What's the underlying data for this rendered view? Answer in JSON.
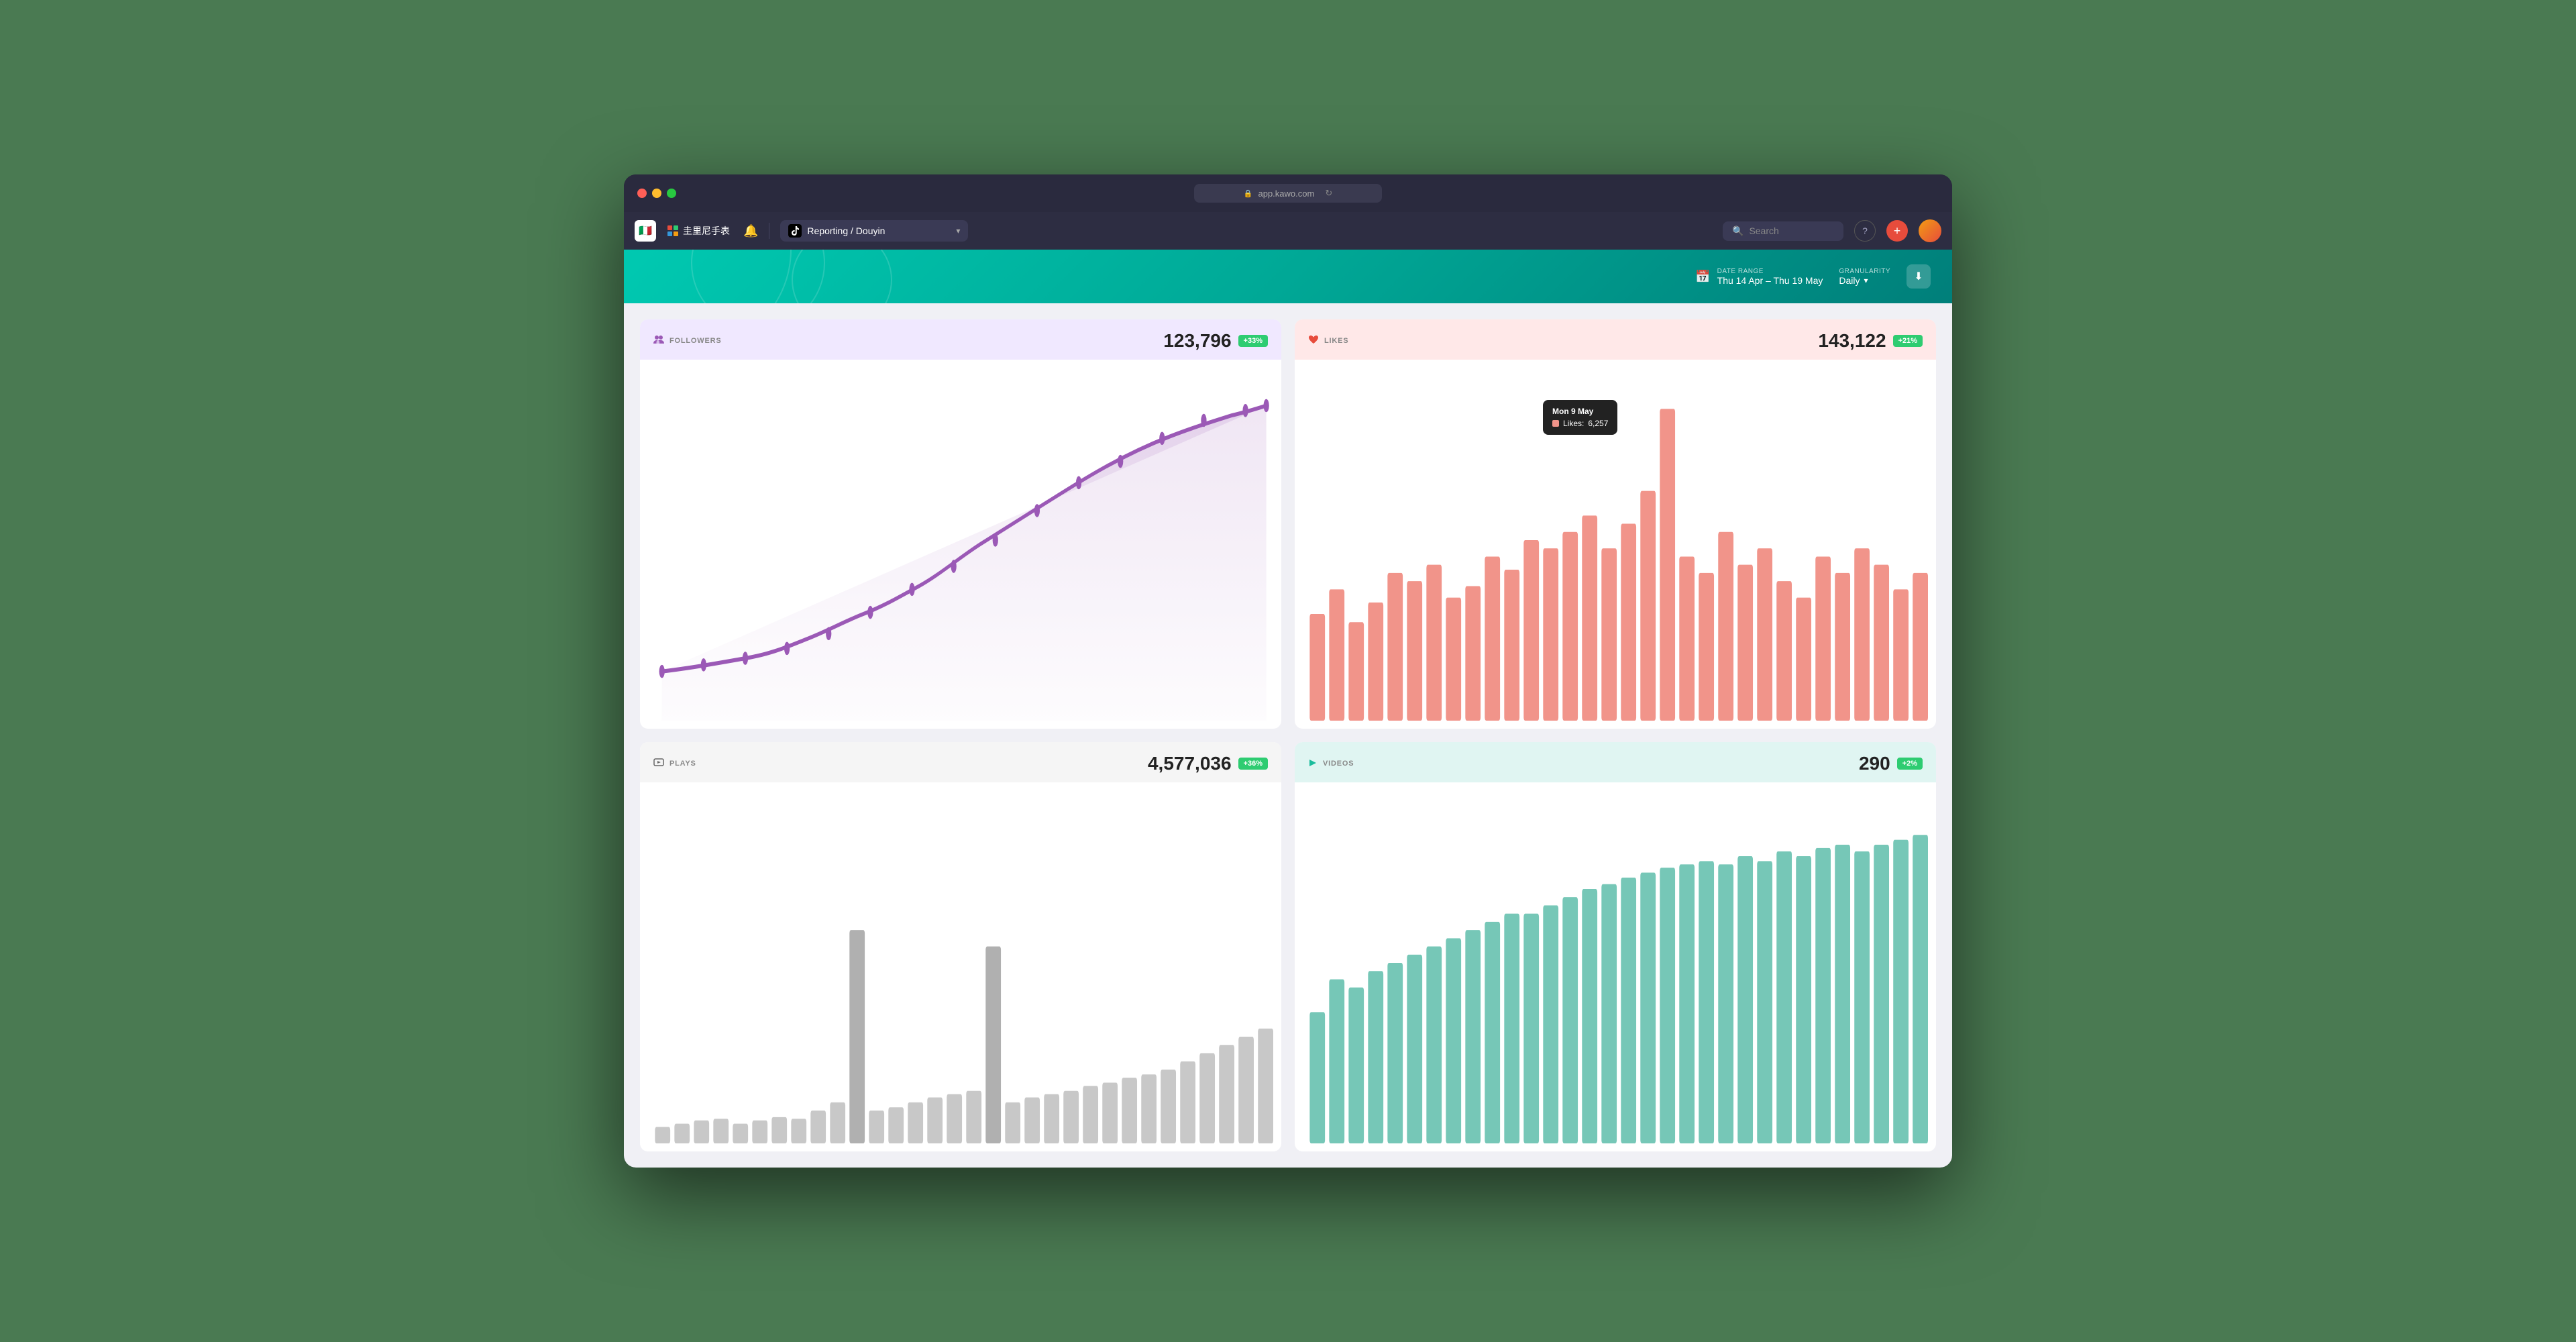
{
  "window": {
    "title": "app.kawo.com"
  },
  "nav": {
    "logo_emoji": "🇮🇹",
    "account_name": "圭里尼手表",
    "bell_label": "🔔",
    "platform": "Reporting / Douyin",
    "chevron": "▾",
    "search_placeholder": "Search",
    "help_label": "?",
    "add_label": "+"
  },
  "report_header": {
    "date_range_label": "DATE RANGE",
    "date_range_value": "Thu 14 Apr – Thu 19 May",
    "granularity_label": "GRANULARITY",
    "granularity_value": "Daily",
    "download_label": "⬇"
  },
  "cards": {
    "followers": {
      "label": "FOLLOWERS",
      "value": "123,796",
      "badge": "+33%",
      "icon": "👥"
    },
    "likes": {
      "label": "LIKES",
      "value": "143,122",
      "badge": "+21%",
      "icon": "♥"
    },
    "plays": {
      "label": "PLAYS",
      "value": "4,577,036",
      "badge": "+36%",
      "icon": "▷"
    },
    "videos": {
      "label": "VIDEOS",
      "value": "290",
      "badge": "+2%",
      "icon": "➤"
    }
  },
  "tooltip": {
    "date": "Mon 9 May",
    "label": "Likes:",
    "value": "6,257"
  },
  "colors": {
    "followers_line": "#9b59b6",
    "likes_bar": "#f1948a",
    "plays_bar": "#bbb",
    "videos_bar": "#76c7b7",
    "badge_green": "#2ecc71",
    "teal_header": "#00c9b1"
  }
}
